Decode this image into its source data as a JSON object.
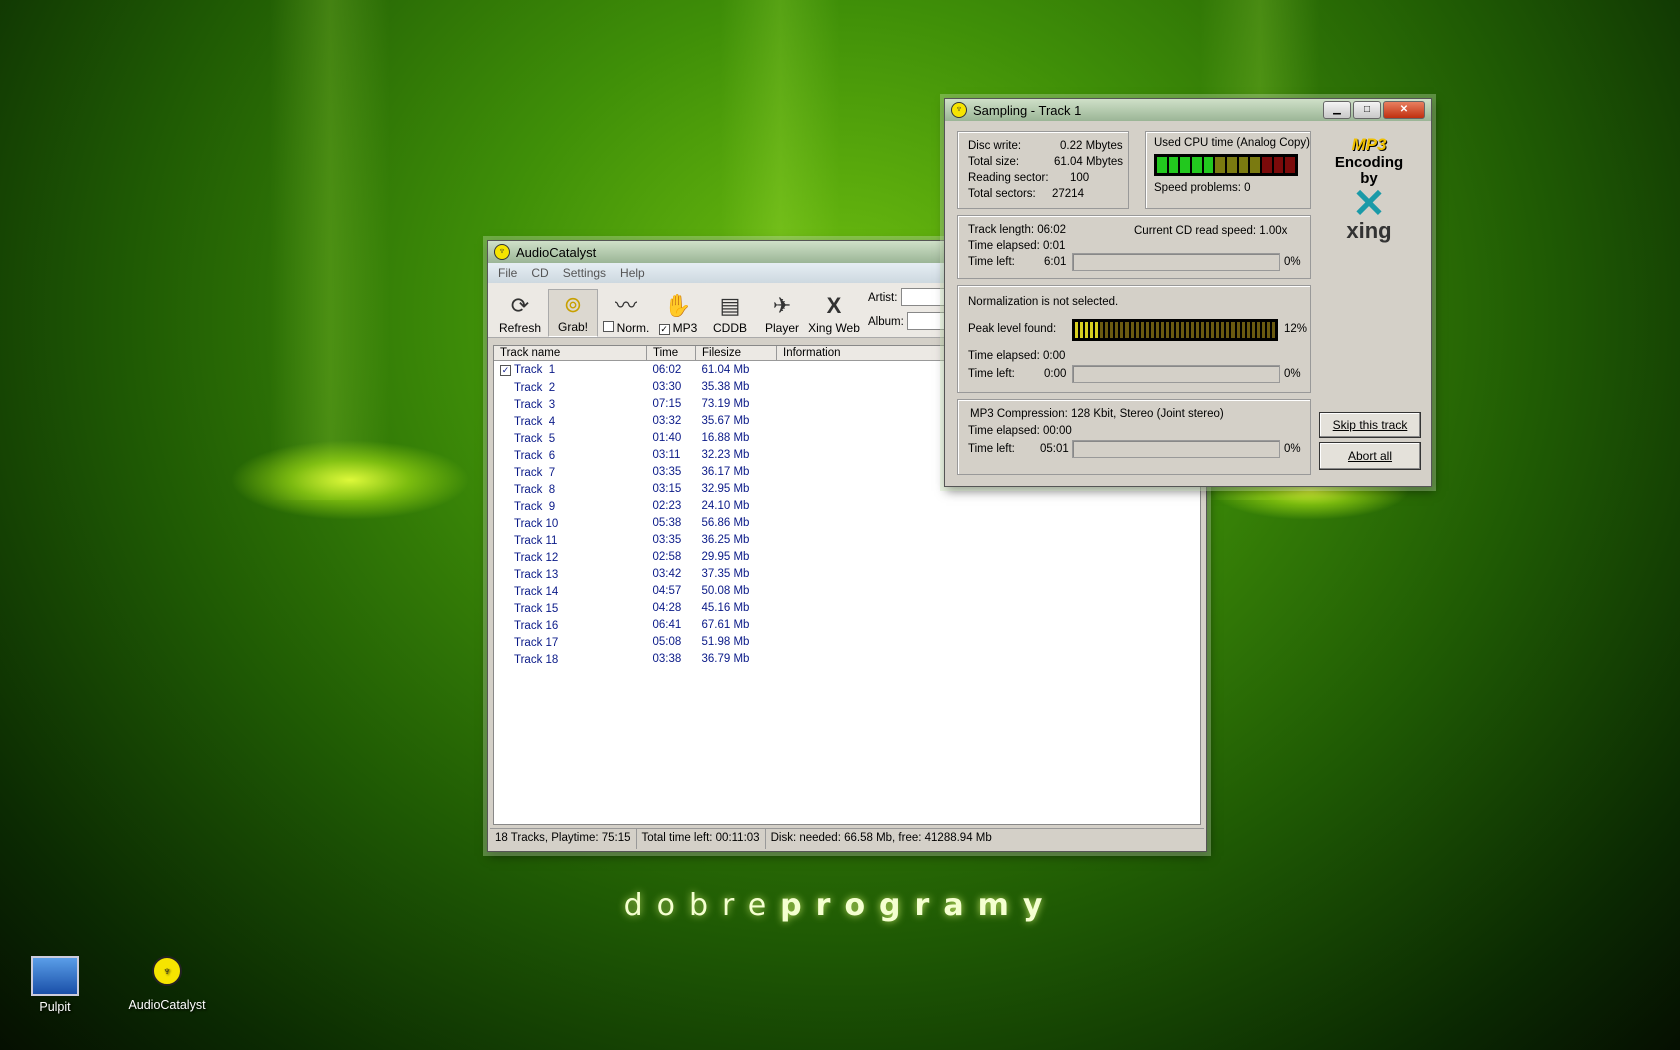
{
  "wallpaper": {
    "text_light": "dobre",
    "text_bold": "programy"
  },
  "desktop": {
    "icons": [
      {
        "label": "Pulpit"
      },
      {
        "label": "AudioCatalyst"
      }
    ]
  },
  "main_window": {
    "title": "AudioCatalyst",
    "menu": [
      "File",
      "CD",
      "Settings",
      "Help"
    ],
    "toolbar": [
      {
        "label": "Refresh",
        "icon": "refresh-icon"
      },
      {
        "label": "Grab!",
        "icon": "grab-cd-icon"
      },
      {
        "label": "Norm.",
        "icon": "normalize-icon",
        "checked": false
      },
      {
        "label": "MP3",
        "icon": "mp3-hand-icon",
        "checked": true
      },
      {
        "label": "CDDB",
        "icon": "cddb-icon"
      },
      {
        "label": "Player",
        "icon": "player-icon"
      },
      {
        "label": "Xing Web",
        "icon": "xing-icon"
      }
    ],
    "artist_label": "Artist:",
    "album_label": "Album:",
    "columns": [
      "Track name",
      "Time",
      "Filesize",
      "Information"
    ],
    "tracks": [
      {
        "name": "Track  1",
        "time": "06:02",
        "size": "61.04 Mb",
        "checked": true
      },
      {
        "name": "Track  2",
        "time": "03:30",
        "size": "35.38 Mb"
      },
      {
        "name": "Track  3",
        "time": "07:15",
        "size": "73.19 Mb"
      },
      {
        "name": "Track  4",
        "time": "03:32",
        "size": "35.67 Mb"
      },
      {
        "name": "Track  5",
        "time": "01:40",
        "size": "16.88 Mb"
      },
      {
        "name": "Track  6",
        "time": "03:11",
        "size": "32.23 Mb"
      },
      {
        "name": "Track  7",
        "time": "03:35",
        "size": "36.17 Mb"
      },
      {
        "name": "Track  8",
        "time": "03:15",
        "size": "32.95 Mb"
      },
      {
        "name": "Track  9",
        "time": "02:23",
        "size": "24.10 Mb"
      },
      {
        "name": "Track 10",
        "time": "05:38",
        "size": "56.86 Mb"
      },
      {
        "name": "Track 11",
        "time": "03:35",
        "size": "36.25 Mb"
      },
      {
        "name": "Track 12",
        "time": "02:58",
        "size": "29.95 Mb"
      },
      {
        "name": "Track 13",
        "time": "03:42",
        "size": "37.35 Mb"
      },
      {
        "name": "Track 14",
        "time": "04:57",
        "size": "50.08 Mb"
      },
      {
        "name": "Track 15",
        "time": "04:28",
        "size": "45.16 Mb"
      },
      {
        "name": "Track 16",
        "time": "06:41",
        "size": "67.61 Mb"
      },
      {
        "name": "Track 17",
        "time": "05:08",
        "size": "51.98 Mb"
      },
      {
        "name": "Track 18",
        "time": "03:38",
        "size": "36.79 Mb"
      }
    ],
    "status": {
      "tracks": "18 Tracks,  Playtime: 75:15",
      "total_time": "Total time left: 00:11:03",
      "disk": "Disk: needed: 66.58 Mb, free: 41288.94 Mb"
    }
  },
  "sampling_window": {
    "title": "Sampling  - Track  1",
    "disc_write_label": "Disc write:",
    "disc_write": "0.22 Mbytes",
    "total_size_label": "Total size:",
    "total_size": "61.04 Mbytes",
    "reading_sector_label": "Reading sector:",
    "reading_sector": "100",
    "total_sectors_label": "Total sectors:",
    "total_sectors": "27214",
    "cpu_label": "Used CPU time (Analog Copy)",
    "speed_problems": "Speed problems: 0",
    "track_length": "Track length:  06:02",
    "read_speed": "Current CD read speed: 1.00x",
    "te1": "Time elapsed:  0:01",
    "tl1_label": "Time left:",
    "tl1": "6:01",
    "pct1": "0%",
    "norm_text": "Normalization is not selected.",
    "peak_label": "Peak level found:",
    "peak_pct": "12%",
    "te2": "Time elapsed:  0:00",
    "tl2_label": "Time left:",
    "tl2": "0:00",
    "pct2": "0%",
    "compression": "MP3 Compression: 128 Kbit, Stereo (Joint stereo)",
    "te3": "Time elapsed:  00:00",
    "tl3_label": "Time left:",
    "tl3": "05:01",
    "pct3": "0%",
    "logo_mp3": "MP3",
    "logo_encoding": "Encoding",
    "logo_by": "by",
    "logo_xing": "xing",
    "skip_button": "Skip this track",
    "abort_button": "Abort all",
    "progress": {
      "cpu_fraction": 0.4,
      "peak_fraction": 0.12
    },
    "colors": {
      "meter_on": "#22c81e",
      "meter_mid": "#7a7a10",
      "meter_off": "#7a0a0a",
      "peak_on": "#d8d020",
      "peak_off": "#6a5a10"
    }
  }
}
